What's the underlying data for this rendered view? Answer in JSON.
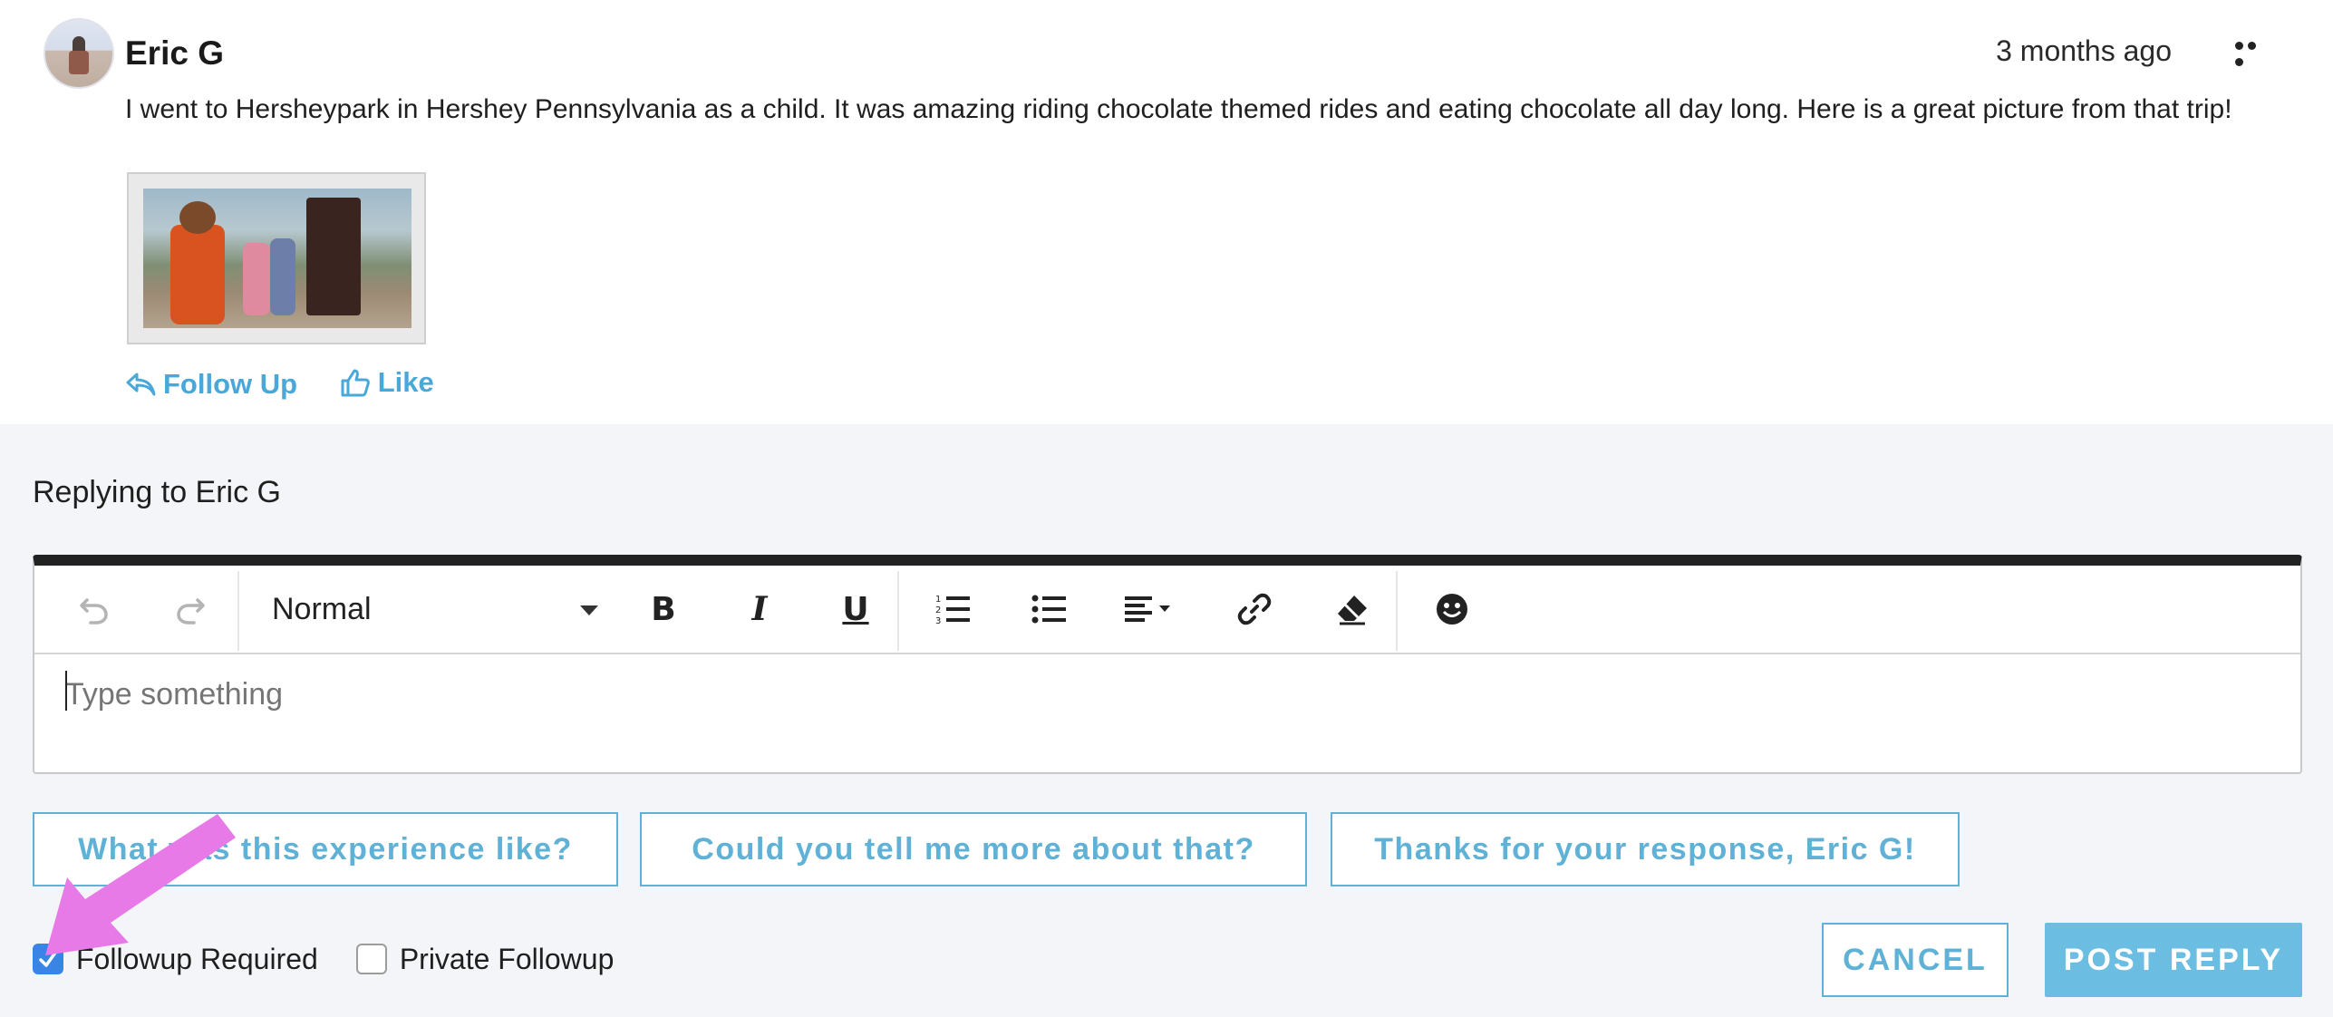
{
  "post": {
    "author": "Eric G",
    "time": "3 months ago",
    "body": "I went to Hersheypark in Hershey Pennsylvania as a child. It was amazing riding chocolate themed rides and eating chocolate all day long. Here is a great picture from that trip!",
    "actions": {
      "follow_up": "Follow Up",
      "like": "Like"
    }
  },
  "reply": {
    "title": "Replying to Eric G",
    "toolbar": {
      "format_value": "Normal",
      "bold": "B",
      "italic": "I",
      "underline": "U"
    },
    "placeholder": "Type something",
    "suggestions": [
      "What was this experience like?",
      "Could you tell me more about that?",
      "Thanks for your response, Eric G!"
    ],
    "checkboxes": {
      "followup_required": {
        "label": "Followup Required",
        "checked": true
      },
      "private_followup": {
        "label": "Private Followup",
        "checked": false
      }
    },
    "buttons": {
      "cancel": "CANCEL",
      "post": "POST REPLY"
    }
  },
  "colors": {
    "accent": "#5fb1d6",
    "primary_button": "#6bbde2",
    "checkbox_checked": "#3a84e6",
    "annotation_arrow": "#e87ae8",
    "reply_background": "#f4f5f9"
  },
  "icons": [
    "undo-icon",
    "redo-icon",
    "bold-icon",
    "italic-icon",
    "underline-icon",
    "ordered-list-icon",
    "bullet-list-icon",
    "align-icon",
    "link-icon",
    "eraser-icon",
    "emoji-icon",
    "reply-icon",
    "thumbs-up-icon",
    "more-icon"
  ]
}
